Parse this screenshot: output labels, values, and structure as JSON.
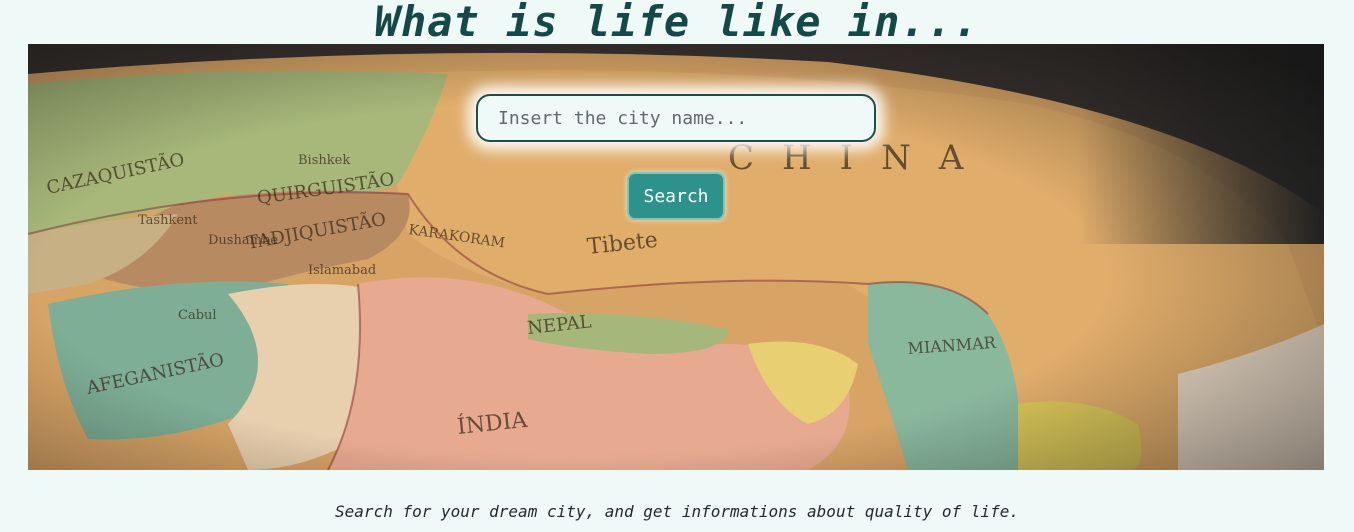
{
  "header": {
    "title": "What is life like in..."
  },
  "search": {
    "placeholder": "Insert the city name...",
    "value": "",
    "button_label": "Search"
  },
  "footer": {
    "tagline": "Search for your dream city, and get informations about quality of life."
  },
  "hero_map": {
    "labels": [
      "CAZAQUISTÃO",
      "QUIRGUISTÃO",
      "TADJIQUISTÃO",
      "AFEGANISTÃO",
      "CHINA",
      "Tibete",
      "NEPAL",
      "ÍNDIA",
      "MIANMAR",
      "KARAKORAM",
      "Bishkek",
      "Tashkent",
      "Dushambe",
      "Islamabad",
      "Cabul"
    ]
  },
  "colors": {
    "background": "#eff9f8",
    "title": "#154848",
    "button": "#2d928c",
    "input_border": "#1d4f4a"
  }
}
